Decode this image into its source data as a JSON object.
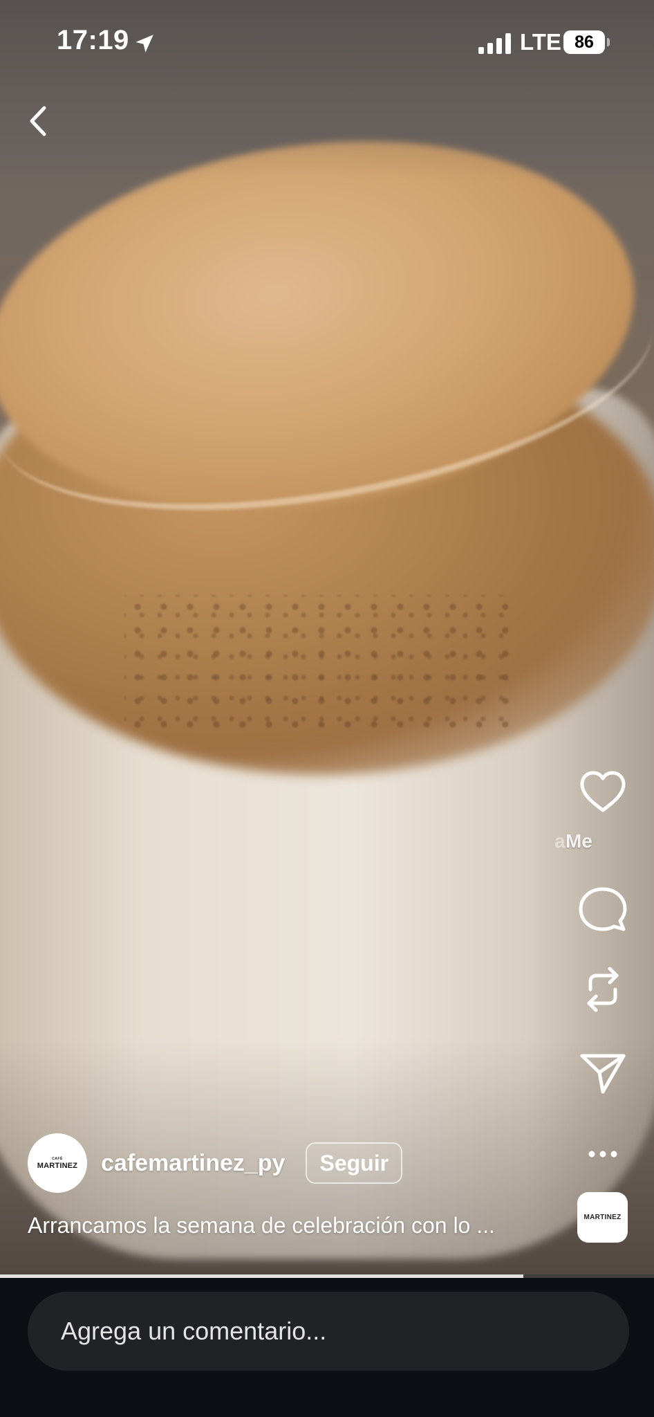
{
  "status_bar": {
    "time": "17:19",
    "network": "LTE",
    "battery": "86"
  },
  "post": {
    "username": "cafemartinez_py",
    "follow_label": "Seguir",
    "caption": "Arrancamos la semana de celebración con lo ...",
    "avatar_brand": "MARTINEZ",
    "avatar_small": "CAFÉ",
    "likes_text": "Me",
    "likes_text_fade": "a",
    "progress": 0.8
  },
  "audio": {
    "thumb_label": "MARTINEZ"
  },
  "comment": {
    "placeholder": "Agrega un comentario..."
  },
  "icons": {
    "back": "chevron-left-icon",
    "like": "heart-icon",
    "comment": "comment-bubble-icon",
    "repost": "repost-icon",
    "share": "paper-plane-icon",
    "more": "more-dots-icon"
  }
}
